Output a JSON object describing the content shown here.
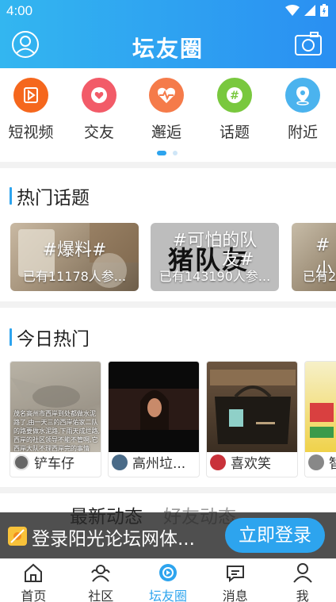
{
  "status": {
    "time": "4:00"
  },
  "header": {
    "title": "坛友圈"
  },
  "categories": [
    {
      "label": "短视频",
      "color": "#f5671d"
    },
    {
      "label": "交友",
      "color": "#f25b68"
    },
    {
      "label": "邂逅",
      "color": "#f57b4a"
    },
    {
      "label": "话题",
      "color": "#79c83e"
    },
    {
      "label": "附近",
      "color": "#4bb3ee"
    }
  ],
  "hot_topics": {
    "title": "热门话题",
    "items": [
      {
        "tag": "#爆料#",
        "count": "已有11178人参..."
      },
      {
        "tag": "#可怕的队",
        "count": "已有143190人参...",
        "overlay": "猪队友",
        "overlay_sub": "友#"
      },
      {
        "tag": "#小",
        "count": "已有2"
      }
    ]
  },
  "today_hot": {
    "title": "今日热门",
    "items": [
      {
        "user": "铲车仔",
        "caption": "茂名高州市西岸到处都做水泥路了,由一天三的西岸佑家二队的路要做水泥路,下雨天成烂路,西岸的社区领导不能不管啊,它西岸大队不理西岸完的事情"
      },
      {
        "user": "高州垃..."
      },
      {
        "user": "喜欢笑"
      },
      {
        "user": "智"
      }
    ]
  },
  "feed_tabs": {
    "latest": "最新动态",
    "friends": "好友动态"
  },
  "login_banner": {
    "text": "登录阳光论坛网体...",
    "button": "立即登录"
  },
  "nav": [
    {
      "label": "首页"
    },
    {
      "label": "社区"
    },
    {
      "label": "坛友圈",
      "active": true
    },
    {
      "label": "消息"
    },
    {
      "label": "我"
    }
  ],
  "colors": {
    "accent": "#2da4ee",
    "header_start": "#33b6f0",
    "header_end": "#2a8ff2"
  }
}
